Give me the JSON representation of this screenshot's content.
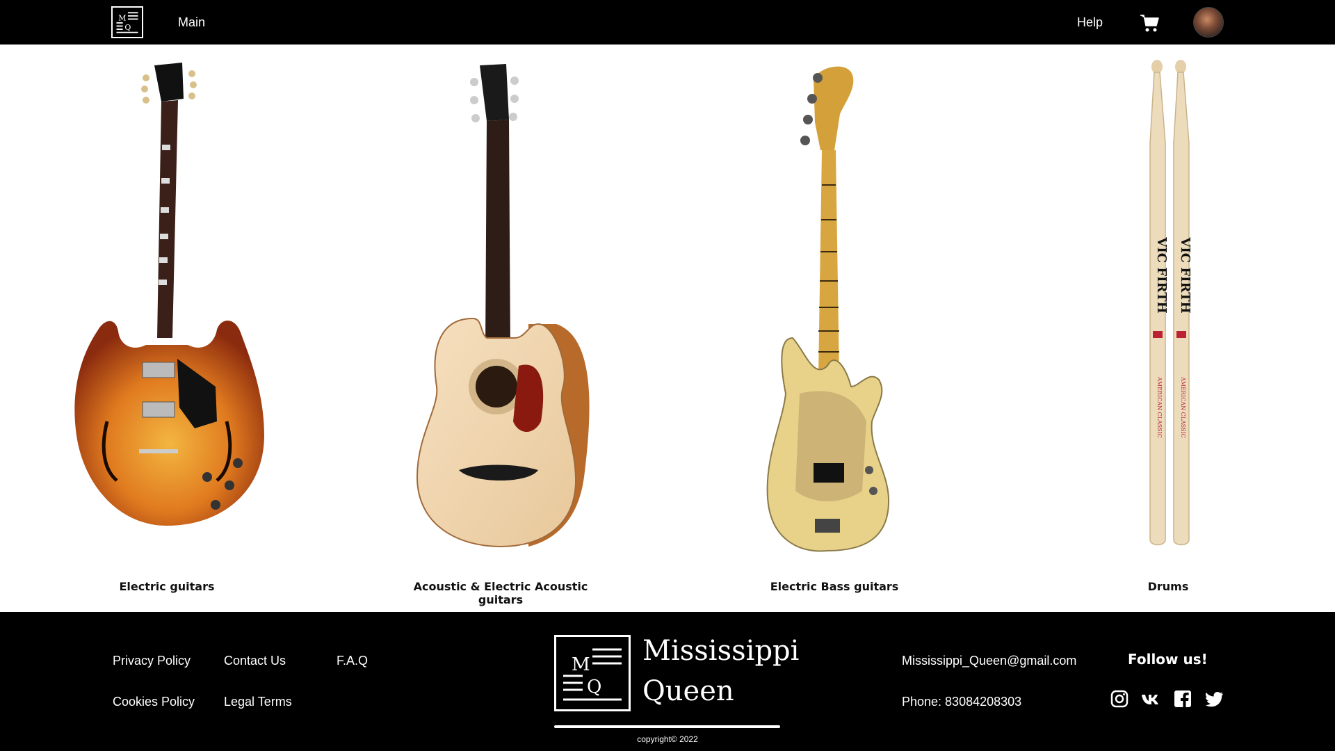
{
  "header": {
    "logo_letters": [
      "M",
      "Q"
    ],
    "nav_main": "Main",
    "nav_help": "Help",
    "cart_icon": "shopping-cart-icon",
    "avatar_icon": "user-avatar"
  },
  "products": [
    {
      "label": "Electric guitars",
      "image": "electric-guitar-image"
    },
    {
      "label": "Acoustic &  Electric Acoustic guitars",
      "image": "acoustic-guitar-image"
    },
    {
      "label": "Electric Bass guitars",
      "image": "bass-guitar-image"
    },
    {
      "label": "Drums",
      "image": "drumsticks-image"
    }
  ],
  "footer": {
    "links": {
      "privacy": "Privacy Policy",
      "contact": "Contact Us",
      "faq": "F.A.Q",
      "cookies": "Cookies Policy",
      "legal": "Legal Terms"
    },
    "brand": {
      "logo_letters": [
        "M",
        "Q"
      ],
      "name_line1": "Mississippi",
      "name_line2": "Queen"
    },
    "email": "Mississippi_Queen@gmail.com",
    "phone": "Phone: 83084208303",
    "follow": "Follow us!",
    "social_icons": [
      "instagram-icon",
      "vk-icon",
      "facebook-icon",
      "twitter-icon"
    ],
    "copyright": "copyright© 2022"
  },
  "colors": {
    "header_bg": "#000000",
    "footer_bg": "#000000",
    "content_bg": "#ffffff",
    "text_light": "#ffffff"
  }
}
